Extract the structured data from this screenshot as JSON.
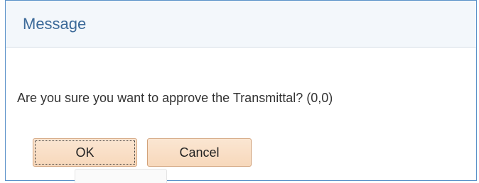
{
  "dialog": {
    "title": "Message",
    "message": "Are you sure you want to approve the Transmittal? (0,0)",
    "buttons": {
      "ok_label": "OK",
      "cancel_label": "Cancel"
    }
  },
  "colors": {
    "border": "#5b92c9",
    "title_text": "#3c6a99",
    "header_bg": "#f3f7fb",
    "button_bg": "#f7d8bb",
    "button_border": "#d2a27a"
  }
}
